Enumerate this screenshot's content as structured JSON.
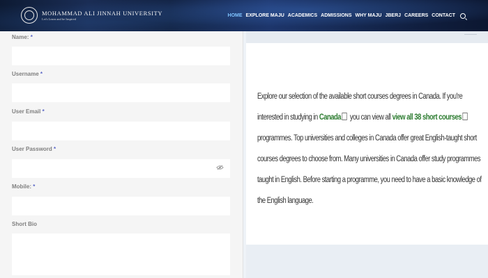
{
  "header": {
    "logo_name": "MOHAMMAD ALI JINNAH UNIVERSITY",
    "logo_tagline": "Let's Learn and be Inspired",
    "nav": [
      {
        "label": "HOME",
        "active": true
      },
      {
        "label": "EXPLORE MAJU",
        "active": false
      },
      {
        "label": "ACADEMICS",
        "active": false
      },
      {
        "label": "ADMISSIONS",
        "active": false
      },
      {
        "label": "WHY MAJU",
        "active": false
      },
      {
        "label": "JBERJ",
        "active": false
      },
      {
        "label": "CAREERS",
        "active": false
      },
      {
        "label": "CONTACT",
        "active": false
      }
    ],
    "accent_color": "#7ec3ff"
  },
  "form": {
    "name_label": "Name:",
    "username_label": "Username",
    "email_label": "User Email",
    "password_label": "User Password",
    "mobile_label": "Mobile:",
    "bio_label": "Short Bio",
    "required_mark": "*",
    "values": {
      "name": "",
      "username": "",
      "email": "",
      "password": "",
      "mobile": "",
      "bio": ""
    },
    "password_toggle_icon": "eye-slash-icon"
  },
  "panel": {
    "text_before": "Explore our selection of the available short courses degrees in Canada. If you're interested in studying in ",
    "link1": "Canada",
    "text_middle": " you can view all ",
    "link2": "view all 38 short courses",
    "text_after": " programmes. Top universities and colleges in Canada offer great English-taught short courses degrees to choose from. Many universities in Canada offer study programmes taught in English. Before starting a programme, you need to have a basic knowledge of the English language.",
    "link_color": "#2e7d32"
  }
}
